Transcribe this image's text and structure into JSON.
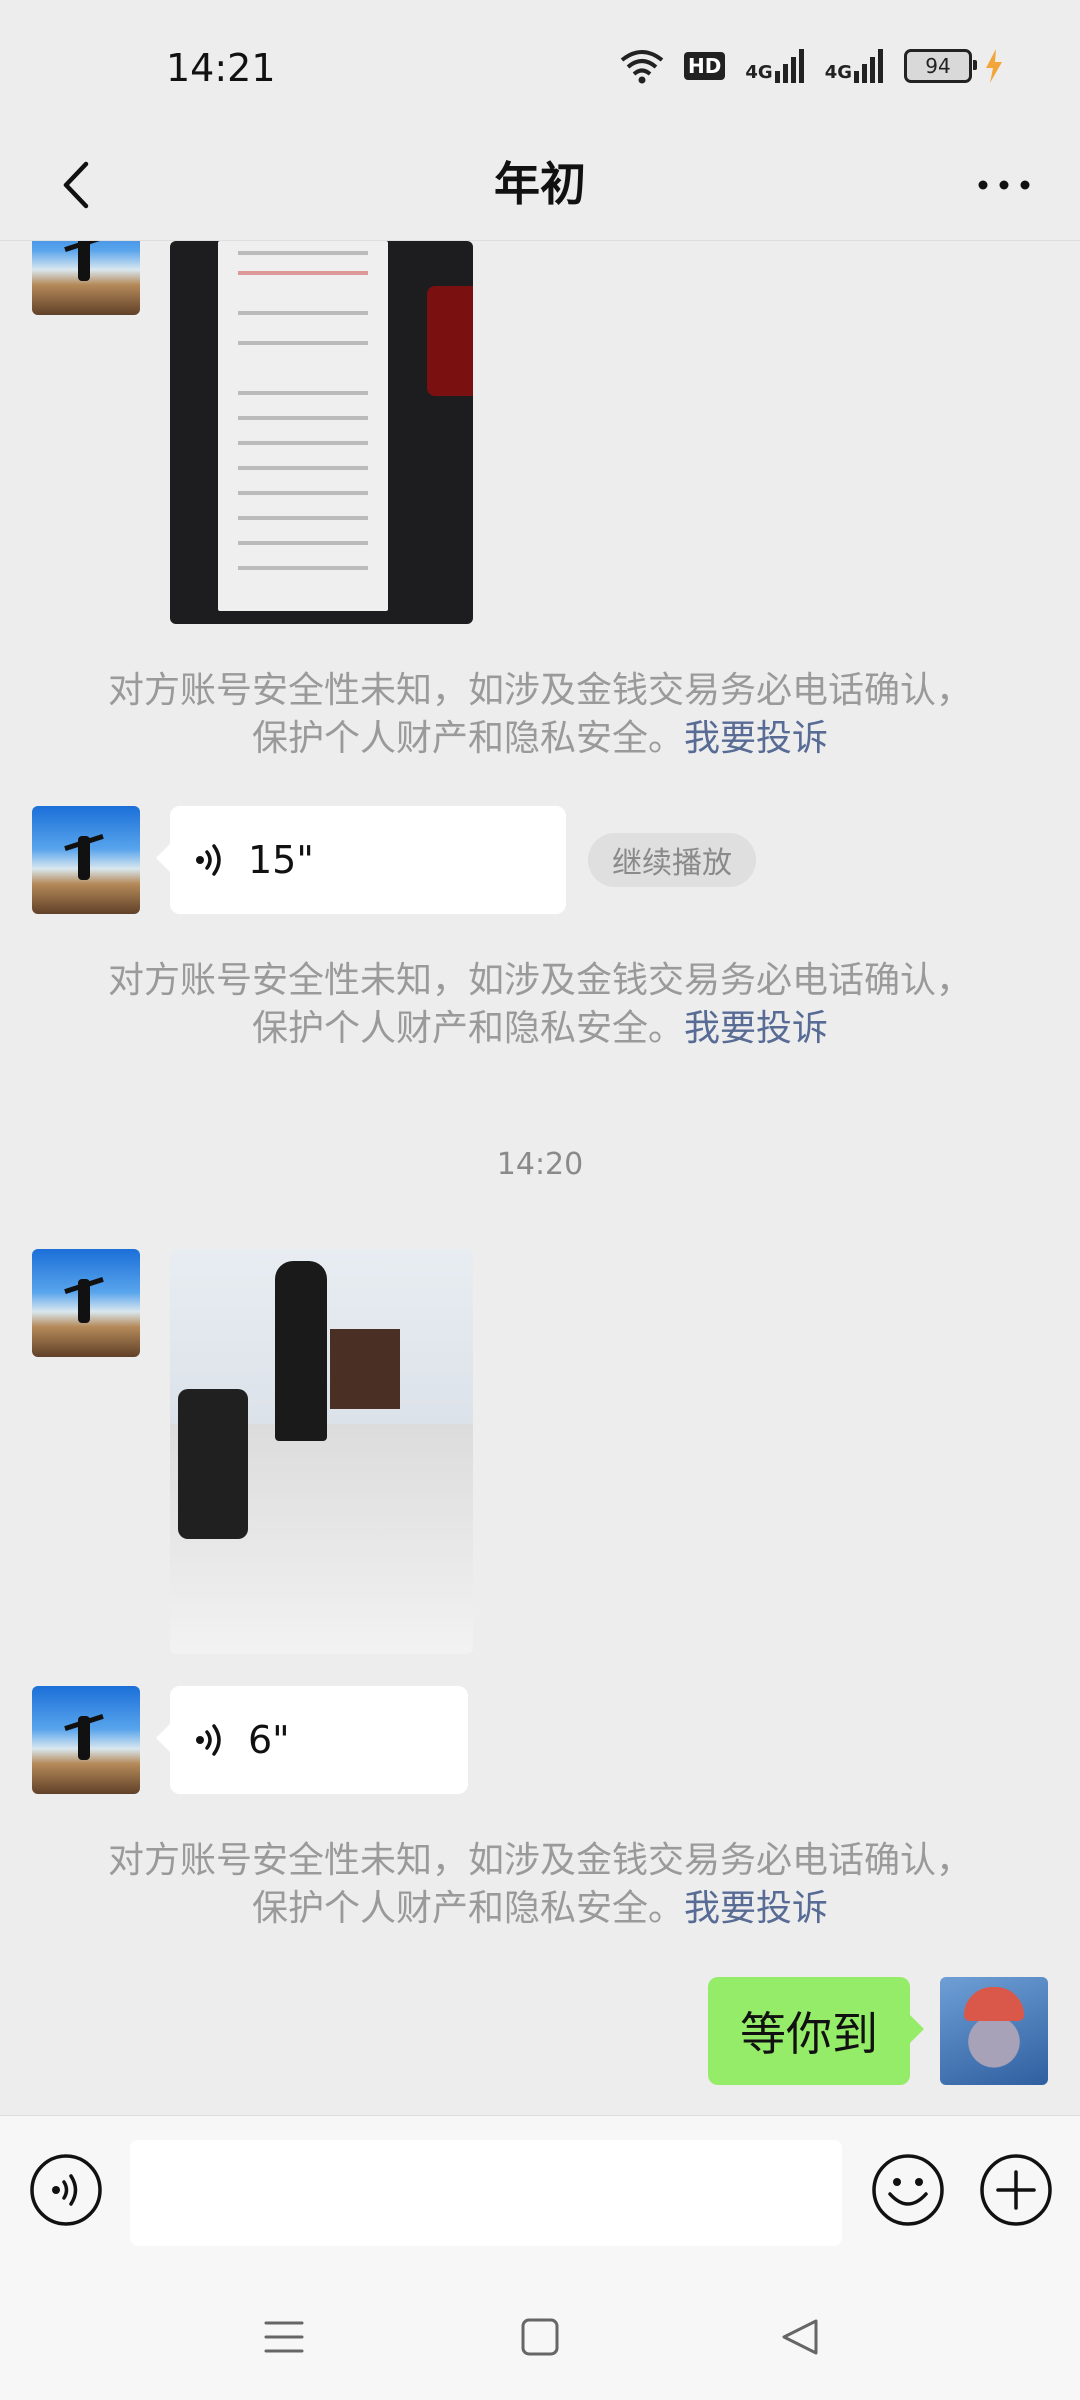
{
  "status_bar": {
    "time": "14:21",
    "wifi_icon": "wifi-icon",
    "hd_label": "HD",
    "signal_1_label": "4G",
    "signal_2_label": "4G",
    "battery": "94",
    "charging_icon": "lightning-icon"
  },
  "nav": {
    "back_icon": "back-arrow-icon",
    "title": "年初",
    "more_icon": "more-dots-icon"
  },
  "messages": {
    "voice_1": {
      "duration": "15\"",
      "continue_label": "继续播放"
    },
    "timestamp": "14:20",
    "voice_2": {
      "duration": "6\""
    },
    "sent_text": "等你到"
  },
  "warning": {
    "line1": "对方账号安全性未知，如涉及金钱交易务必电话确认，",
    "line2": "保护个人财产和隐私安全。",
    "report_link": "我要投诉"
  },
  "input_bar": {
    "voice_toggle_icon": "voice-toggle-icon",
    "emoji_icon": "emoji-icon",
    "plus_icon": "plus-icon",
    "input_value": ""
  },
  "system_nav": {
    "menu_icon": "menu-icon",
    "home_icon": "home-icon",
    "back_icon": "back-triangle-icon"
  },
  "colors": {
    "background": "#ededed",
    "sent_bubble": "#95ec69",
    "link": "#576b95",
    "warning_text": "#9a9a9a"
  }
}
